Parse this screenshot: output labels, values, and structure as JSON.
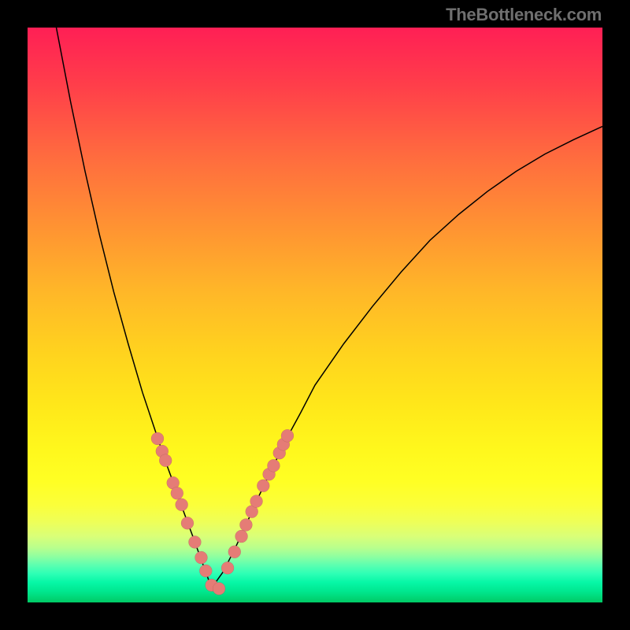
{
  "watermark": "TheBottleneck.com",
  "colors": {
    "frame": "#000000",
    "gradient_top": "#ff1f55",
    "gradient_bottom": "#00ca65",
    "curve": "#000000",
    "dot": "#e57c76"
  },
  "chart_data": {
    "type": "line",
    "title": "",
    "xlabel": "",
    "ylabel": "",
    "xlim": [
      0,
      100
    ],
    "ylim": [
      0,
      100
    ],
    "grid": false,
    "legend": false,
    "annotations": [
      "TheBottleneck.com"
    ],
    "series": [
      {
        "name": "left-curve",
        "x": [
          5.0,
          7.5,
          10.0,
          12.5,
          15.0,
          17.5,
          20.0,
          21.0,
          22.0,
          23.0,
          24.0,
          25.0,
          26.0,
          27.0,
          28.0,
          29.0,
          30.0,
          31.0,
          32.0
        ],
        "values": [
          100.0,
          87.0,
          75.0,
          64.0,
          54.0,
          45.0,
          36.5,
          33.5,
          30.5,
          27.5,
          24.5,
          21.8,
          19.0,
          16.2,
          13.5,
          10.8,
          8.0,
          5.3,
          2.5
        ]
      },
      {
        "name": "right-curve",
        "x": [
          32.0,
          34.0,
          36.0,
          38.0,
          40.0,
          42.5,
          45.0,
          47.5,
          50.0,
          55.0,
          60.0,
          65.0,
          70.0,
          75.0,
          80.0,
          85.0,
          90.0,
          95.0,
          100.0
        ],
        "values": [
          2.5,
          5.3,
          9.2,
          13.5,
          18.0,
          23.2,
          28.4,
          33.0,
          37.8,
          45.0,
          51.5,
          57.5,
          63.0,
          67.5,
          71.5,
          75.0,
          78.0,
          80.5,
          82.8
        ]
      },
      {
        "name": "left-dots",
        "x": [
          22.6,
          23.4,
          24.0,
          25.3,
          26.0,
          26.8,
          27.8,
          29.1,
          30.2,
          31.0,
          32.0,
          33.3
        ],
        "values": [
          28.5,
          26.3,
          24.7,
          20.8,
          19.0,
          17.0,
          13.8,
          10.5,
          7.8,
          5.5,
          3.0,
          2.4
        ]
      },
      {
        "name": "right-dots",
        "x": [
          34.8,
          36.0,
          37.2,
          38.0,
          39.0,
          39.8,
          41.0,
          42.0,
          42.8,
          43.8,
          44.5,
          45.2
        ],
        "values": [
          6.0,
          8.8,
          11.5,
          13.5,
          15.8,
          17.6,
          20.3,
          22.3,
          23.8,
          26.0,
          27.5,
          29.0
        ]
      }
    ]
  }
}
